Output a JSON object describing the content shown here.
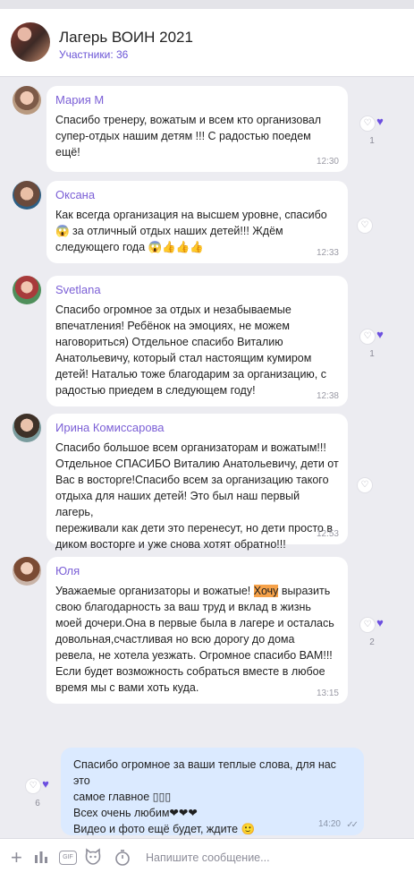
{
  "header": {
    "title": "Лагерь ВОИН 2021",
    "subtitle": "Участники: 36"
  },
  "messages": [
    {
      "name": "Мария М",
      "text": "Спасибо  тренеру, вожатым и всем кто организовал\nсупер-отдых нашим детям !!! С радостью поедем\nещё!",
      "time": "12:30",
      "reactions": "1"
    },
    {
      "name": "Оксана",
      "text": "Как всегда организация на высшем уровне, спасибо\n😱 за отличный отдых наших детей!!! Ждём\nследующего года 😱👍👍👍",
      "time": "12:33",
      "reactions": ""
    },
    {
      "name": "Svetlana",
      "text": "Спасибо огромное за отдых и незабываемые\nвпечатления! Ребёнок на эмоциях, не можем\nнаговориться) Отдельное спасибо Виталию\nАнатольевичу, который стал настоящим кумиром\nдетей! Наталью тоже благодарим за организацию, с\nрадостью приедем в следующем году!",
      "time": "12:38",
      "reactions": "1"
    },
    {
      "name": "Ирина Комиссарова",
      "text": "Спасибо большое всем организаторам и вожатым!!!\nОтдельное СПАСИБО Виталию Анатольевичу, дети от\nВас в восторге!Спасибо всем за организацию такого\nотдыха для наших детей! Это был наш первый лагерь,\nпереживали как дети это перенесут, но дети просто в\nдиком восторге и уже снова хотят обратно!!!",
      "time": "12:53",
      "reactions": ""
    },
    {
      "name": "Юля",
      "text_before": "Уважаемые организаторы и вожатые! ",
      "highlight": "Хочу",
      "text_after": " выразить\nсвою благодарность за ваш труд и вклад в жизнь\nмоей дочери.Она в первые была в лагере и осталась\nдовольная,счастливая но всю дорогу  до дома\nревела, не хотела уезжать. Огромное спасибо ВАМ!!!\nЕсли будет возможность собраться вместе в любое\nвремя мы с вами хоть куда.",
      "time": "13:15",
      "reactions": "2"
    }
  ],
  "outgoing": {
    "text": "Спасибо огромное за ваши теплые слова, для нас это\nсамое главное ▯▯▯\nВсех очень любим❤❤❤\nВидео и фото ещё будет, ждите 🙂",
    "time": "14:20",
    "ticks": "✓✓",
    "reactions": "6"
  },
  "composer": {
    "placeholder": "Напишите сообщение...",
    "gif_label": "GIF"
  },
  "icons": {
    "heart_outline": "heart-outline-icon",
    "heart_filled": "heart-filled-icon",
    "plus": "plus-icon",
    "poll": "poll-icon",
    "gif": "gif-icon",
    "sticker": "sticker-icon",
    "timer": "timer-icon"
  },
  "colors": {
    "accent": "#6c4fe0",
    "name": "#7b5fd6",
    "outgoing_bubble": "#dbeaff",
    "highlight": "#f6a24a"
  }
}
